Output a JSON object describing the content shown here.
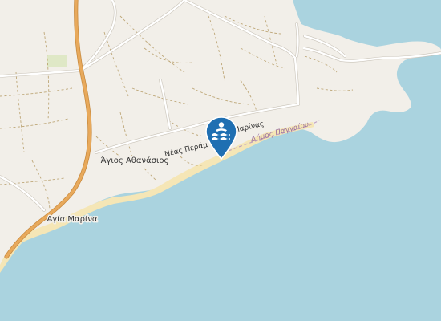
{
  "map": {
    "colors": {
      "land": "#f2efe9",
      "sea": "#aad3df",
      "beach": "#f5e6b6",
      "motorway": "#e8a95b",
      "road": "#ffffff",
      "track": "#b59b65",
      "marker": "#1f6fb2"
    },
    "labels": {
      "village_agios": "Άγιος Αθανάσιος",
      "village_agia_marina": "Αγία Μαρίνα",
      "road_neas_peramou_a": "Νέας Περάμ",
      "road_neas_peramou_b": "Μαρίνας",
      "boundary": "Δήμος Παγγαίου"
    },
    "marker": {
      "icon": "swimming-beach-icon"
    }
  }
}
